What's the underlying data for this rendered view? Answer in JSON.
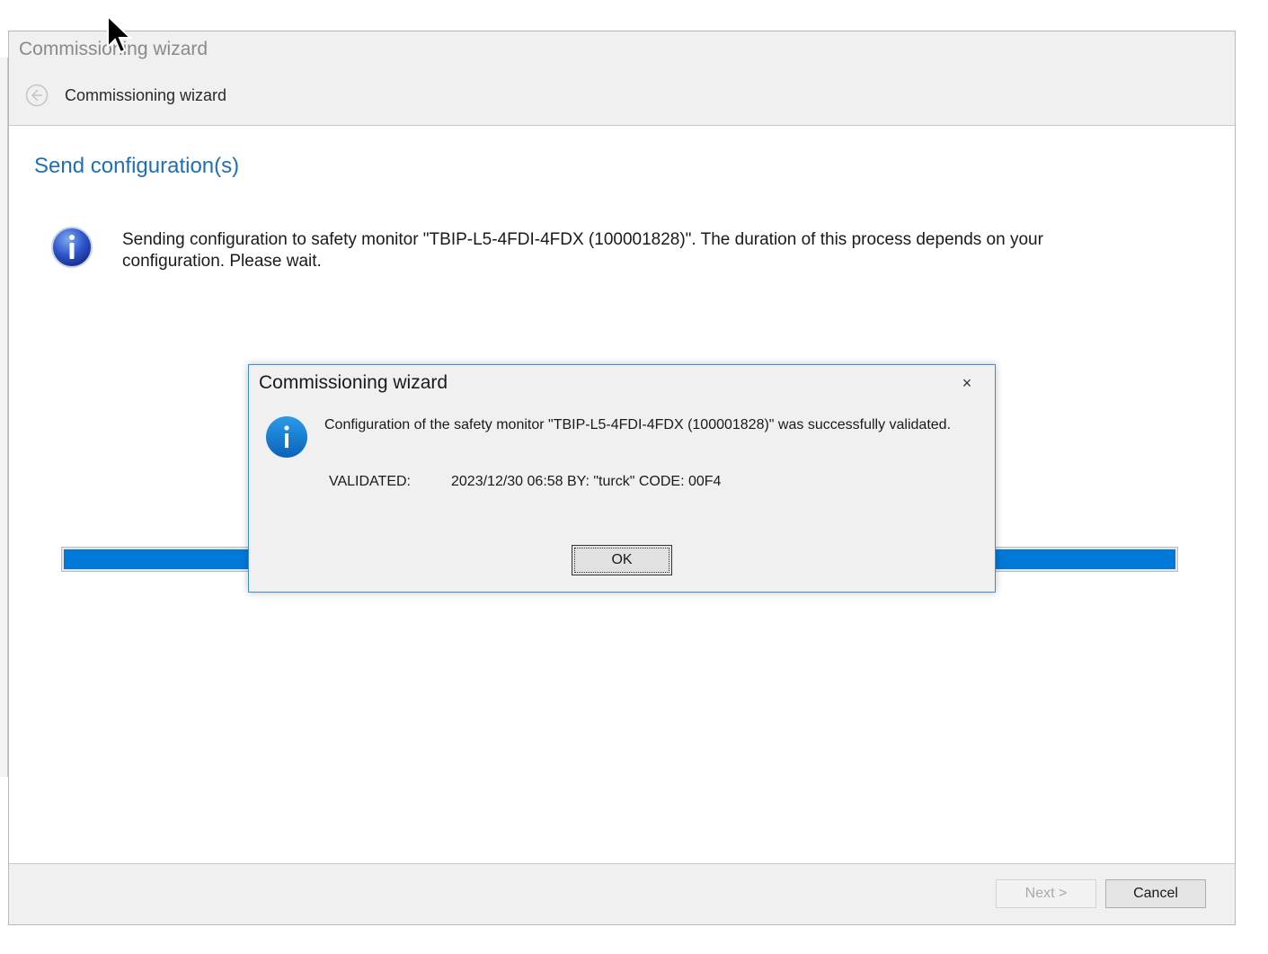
{
  "window": {
    "title": "Commissioning wizard",
    "nav_title": "Commissioning wizard"
  },
  "content": {
    "heading": "Send configuration(s)",
    "message": "Sending configuration to safety monitor \"TBIP-L5-4FDI-4FDX (100001828)\". The duration of this process depends on your configuration. Please wait.",
    "progress_fraction": 1.0
  },
  "footer": {
    "next_label": "Next >",
    "cancel_label": "Cancel"
  },
  "dialog": {
    "title": "Commissioning wizard",
    "close_glyph": "×",
    "message": "Configuration of the safety monitor \"TBIP-L5-4FDI-4FDX (100001828)\" was successfully validated.",
    "validated_label": "VALIDATED:",
    "validated_value": "2023/12/30 06:58 BY: \"turck\" CODE: 00F4",
    "ok_label": "OK"
  },
  "colors": {
    "accent": "#1f6fb5",
    "progress": "#0078d7",
    "dialog_border": "#3d8ed8"
  }
}
